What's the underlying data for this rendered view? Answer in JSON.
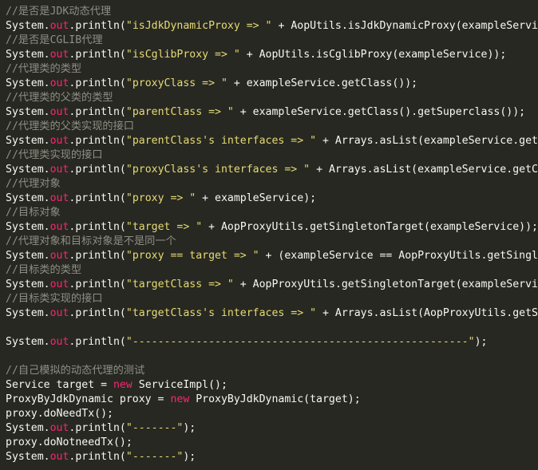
{
  "colors": {
    "background": "#272822",
    "text": "#f8f8f2",
    "comment": "#8e8e84",
    "keyword_field": "#f92672",
    "string": "#e6db74"
  },
  "lines": [
    [
      [
        "c",
        "//是否是JDK动态代理"
      ]
    ],
    [
      [
        "p",
        "System."
      ],
      [
        "f",
        "out"
      ],
      [
        "p",
        ".println("
      ],
      [
        "s",
        "\"isJdkDynamicProxy => \""
      ],
      [
        "p",
        " + AopUtils.isJdkDynamicProxy(exampleServi"
      ]
    ],
    [
      [
        "c",
        "//是否是CGLIB代理"
      ]
    ],
    [
      [
        "p",
        "System."
      ],
      [
        "f",
        "out"
      ],
      [
        "p",
        ".println("
      ],
      [
        "s",
        "\"isCglibProxy => \""
      ],
      [
        "p",
        " + AopUtils.isCglibProxy(exampleService));"
      ]
    ],
    [
      [
        "c",
        "//代理类的类型"
      ]
    ],
    [
      [
        "p",
        "System."
      ],
      [
        "f",
        "out"
      ],
      [
        "p",
        ".println("
      ],
      [
        "s",
        "\"proxyClass => \""
      ],
      [
        "p",
        " + exampleService.getClass());"
      ]
    ],
    [
      [
        "c",
        "//代理类的父类的类型"
      ]
    ],
    [
      [
        "p",
        "System."
      ],
      [
        "f",
        "out"
      ],
      [
        "p",
        ".println("
      ],
      [
        "s",
        "\"parentClass => \""
      ],
      [
        "p",
        " + exampleService.getClass().getSuperclass());"
      ]
    ],
    [
      [
        "c",
        "//代理类的父类实现的接口"
      ]
    ],
    [
      [
        "p",
        "System."
      ],
      [
        "f",
        "out"
      ],
      [
        "p",
        ".println("
      ],
      [
        "s",
        "\"parentClass's interfaces => \""
      ],
      [
        "p",
        " + Arrays.asList(exampleService.get"
      ]
    ],
    [
      [
        "c",
        "//代理类实现的接口"
      ]
    ],
    [
      [
        "p",
        "System."
      ],
      [
        "f",
        "out"
      ],
      [
        "p",
        ".println("
      ],
      [
        "s",
        "\"proxyClass's interfaces => \""
      ],
      [
        "p",
        " + Arrays.asList(exampleService.getC"
      ]
    ],
    [
      [
        "c",
        "//代理对象"
      ]
    ],
    [
      [
        "p",
        "System."
      ],
      [
        "f",
        "out"
      ],
      [
        "p",
        ".println("
      ],
      [
        "s",
        "\"proxy => \""
      ],
      [
        "p",
        " + exampleService);"
      ]
    ],
    [
      [
        "c",
        "//目标对象"
      ]
    ],
    [
      [
        "p",
        "System."
      ],
      [
        "f",
        "out"
      ],
      [
        "p",
        ".println("
      ],
      [
        "s",
        "\"target => \""
      ],
      [
        "p",
        " + AopProxyUtils.getSingletonTarget(exampleService));"
      ]
    ],
    [
      [
        "c",
        "//代理对象和目标对象是不是同一个"
      ]
    ],
    [
      [
        "p",
        "System."
      ],
      [
        "f",
        "out"
      ],
      [
        "p",
        ".println("
      ],
      [
        "s",
        "\"proxy == target => \""
      ],
      [
        "p",
        " + (exampleService == AopProxyUtils.getSingl"
      ]
    ],
    [
      [
        "c",
        "//目标类的类型"
      ]
    ],
    [
      [
        "p",
        "System."
      ],
      [
        "f",
        "out"
      ],
      [
        "p",
        ".println("
      ],
      [
        "s",
        "\"targetClass => \""
      ],
      [
        "p",
        " + AopProxyUtils.getSingletonTarget(exampleServi"
      ]
    ],
    [
      [
        "c",
        "//目标类实现的接口"
      ]
    ],
    [
      [
        "p",
        "System."
      ],
      [
        "f",
        "out"
      ],
      [
        "p",
        ".println("
      ],
      [
        "s",
        "\"targetClass's interfaces => \""
      ],
      [
        "p",
        " + Arrays.asList(AopProxyUtils.getS"
      ]
    ],
    [],
    [
      [
        "p",
        "System."
      ],
      [
        "f",
        "out"
      ],
      [
        "p",
        ".println("
      ],
      [
        "s",
        "\"-----------------------------------------------------\""
      ],
      [
        "p",
        ");"
      ]
    ],
    [],
    [
      [
        "c",
        "//自己模拟的动态代理的测试"
      ]
    ],
    [
      [
        "p",
        "Service target = "
      ],
      [
        "f",
        "new"
      ],
      [
        "p",
        " ServiceImpl();"
      ]
    ],
    [
      [
        "p",
        "ProxyByJdkDynamic proxy = "
      ],
      [
        "f",
        "new"
      ],
      [
        "p",
        " ProxyByJdkDynamic(target);"
      ]
    ],
    [
      [
        "p",
        "proxy.doNeedTx();"
      ]
    ],
    [
      [
        "p",
        "System."
      ],
      [
        "f",
        "out"
      ],
      [
        "p",
        ".println("
      ],
      [
        "s",
        "\"-------\""
      ],
      [
        "p",
        ");"
      ]
    ],
    [
      [
        "p",
        "proxy.doNotneedTx();"
      ]
    ],
    [
      [
        "p",
        "System."
      ],
      [
        "f",
        "out"
      ],
      [
        "p",
        ".println("
      ],
      [
        "s",
        "\"-------\""
      ],
      [
        "p",
        ");"
      ]
    ]
  ]
}
